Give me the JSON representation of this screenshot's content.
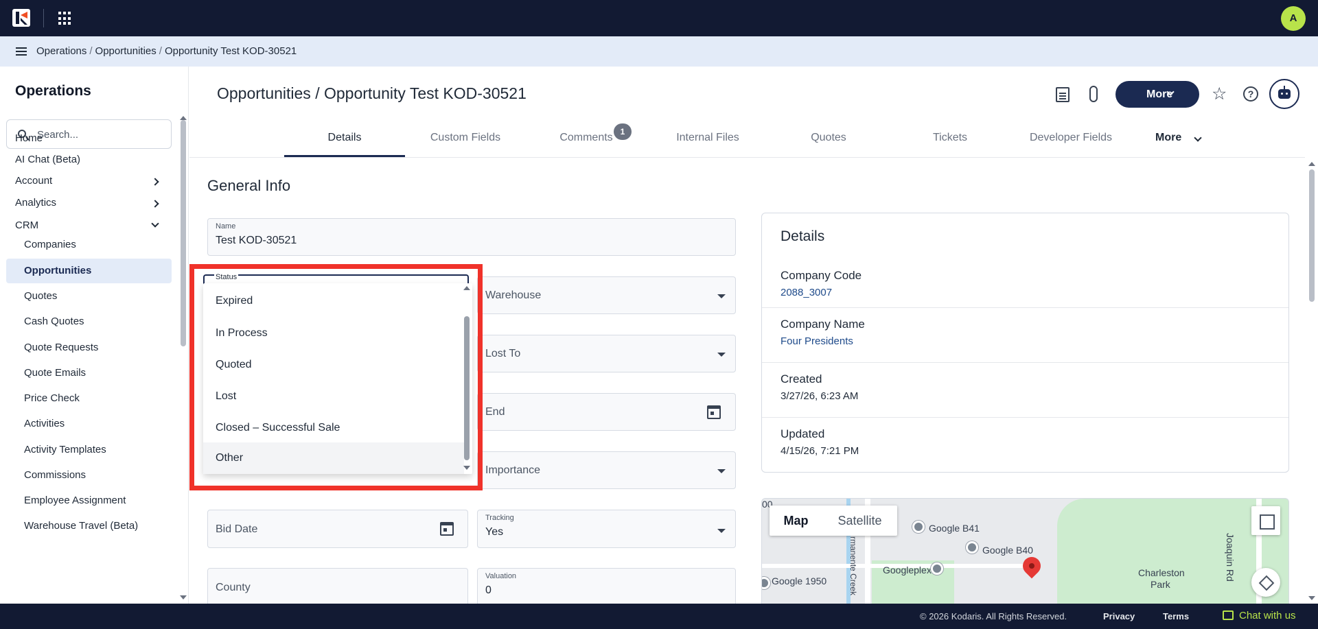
{
  "topbar": {
    "avatar_initial": "A"
  },
  "breadcrumb": {
    "items": [
      "Operations",
      "Opportunities",
      "Opportunity Test KOD-30521"
    ],
    "separator": "/"
  },
  "sidebar": {
    "title": "Operations",
    "search_placeholder": "Search...",
    "top_items": [
      {
        "label": "Home"
      },
      {
        "label": "AI Chat (Beta)"
      },
      {
        "label": "Account"
      },
      {
        "label": "Analytics"
      },
      {
        "label": "CRM"
      }
    ],
    "crm_items": [
      {
        "label": "Companies"
      },
      {
        "label": "Opportunities"
      },
      {
        "label": "Quotes"
      },
      {
        "label": "Cash Quotes"
      },
      {
        "label": "Quote Requests"
      },
      {
        "label": "Quote Emails"
      },
      {
        "label": "Price Check"
      },
      {
        "label": "Activities"
      },
      {
        "label": "Activity Templates"
      },
      {
        "label": "Commissions"
      },
      {
        "label": "Employee Assignment"
      },
      {
        "label": "Warehouse Travel (Beta)"
      }
    ]
  },
  "header": {
    "title": "Opportunities / Opportunity Test KOD-30521",
    "more_label": "More",
    "help_glyph": "?"
  },
  "tabs": {
    "items": [
      {
        "label": "Details"
      },
      {
        "label": "Custom Fields"
      },
      {
        "label": "Comments"
      },
      {
        "label": "Internal Files"
      },
      {
        "label": "Quotes"
      },
      {
        "label": "Tickets"
      },
      {
        "label": "Developer Fields"
      }
    ],
    "comments_badge": "1",
    "more_label": "More"
  },
  "general_info": {
    "title": "General Info",
    "name_label": "Name",
    "name_value": "Test KOD-30521",
    "status_label": "Status",
    "warehouse_placeholder": "Warehouse",
    "lost_to_placeholder": "Lost To",
    "end_placeholder": "End",
    "importance_placeholder": "Importance",
    "bid_date_placeholder": "Bid Date",
    "tracking_label": "Tracking",
    "tracking_value": "Yes",
    "county_placeholder": "County",
    "valuation_label": "Valuation",
    "valuation_value": "0"
  },
  "status_dropdown": {
    "options": [
      "Expired",
      "In Process",
      "Quoted",
      "Lost",
      "Closed – Successful Sale",
      "Other"
    ],
    "hovered": "Other"
  },
  "details_card": {
    "title": "Details",
    "rows": [
      {
        "label": "Company Code",
        "value": "2088_3007"
      },
      {
        "label": "Company Name",
        "value": "Four Presidents"
      },
      {
        "label": "Created",
        "value": "3/27/26, 6:23 AM"
      },
      {
        "label": "Updated",
        "value": "4/15/26, 7:21 PM"
      }
    ]
  },
  "map": {
    "tab_map": "Map",
    "tab_satellite": "Satellite",
    "labels": [
      "Google B41",
      "Google B40",
      "Googleplex",
      "Google 1950",
      "Charleston",
      "Park",
      "Joaquin Rd",
      "rmanente Creek",
      "00"
    ]
  },
  "footer": {
    "copyright": "© 2026 Kodaris. All Rights Reserved.",
    "privacy": "Privacy",
    "terms": "Terms",
    "chat": "Chat with us"
  }
}
